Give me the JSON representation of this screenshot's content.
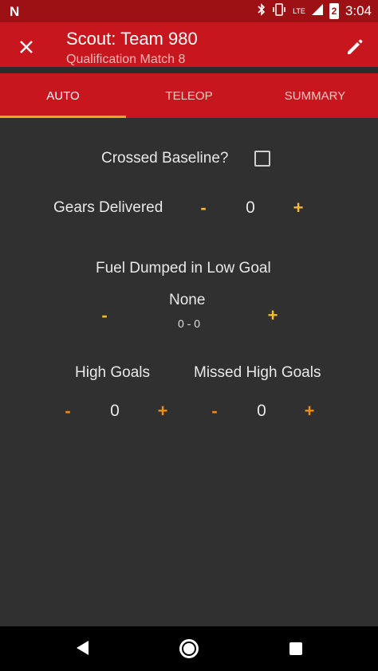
{
  "status_bar": {
    "logo": "N",
    "lte": "LTE",
    "battery_level": "2",
    "time": "3:04"
  },
  "app_bar": {
    "title": "Scout: Team 980",
    "subtitle": "Qualification Match 8",
    "close_icon": "close-icon",
    "edit_icon": "pencil-icon"
  },
  "tabs": [
    {
      "label": "AUTO",
      "active": true
    },
    {
      "label": "TELEOP",
      "active": false
    },
    {
      "label": "SUMMARY",
      "active": false
    }
  ],
  "auto": {
    "crossed_baseline": {
      "label": "Crossed Baseline?",
      "checked": false
    },
    "gears": {
      "label": "Gears Delivered",
      "minus": "-",
      "value": "0",
      "plus": "+"
    },
    "fuel_low": {
      "label": "Fuel Dumped in Low Goal",
      "minus": "-",
      "value": "None",
      "range": "0 - 0",
      "plus": "+"
    },
    "high_goals": {
      "label": "High Goals",
      "minus": "-",
      "value": "0",
      "plus": "+"
    },
    "missed_high": {
      "label": "Missed High Goals",
      "minus": "-",
      "value": "0",
      "plus": "+"
    }
  },
  "colors": {
    "primary": "#c7161d",
    "primary_dark": "#9d1014",
    "background": "#303030",
    "accent": "#f5a623",
    "counter_yellow": "#f5bc2a",
    "counter_orange": "#f08a1c"
  }
}
